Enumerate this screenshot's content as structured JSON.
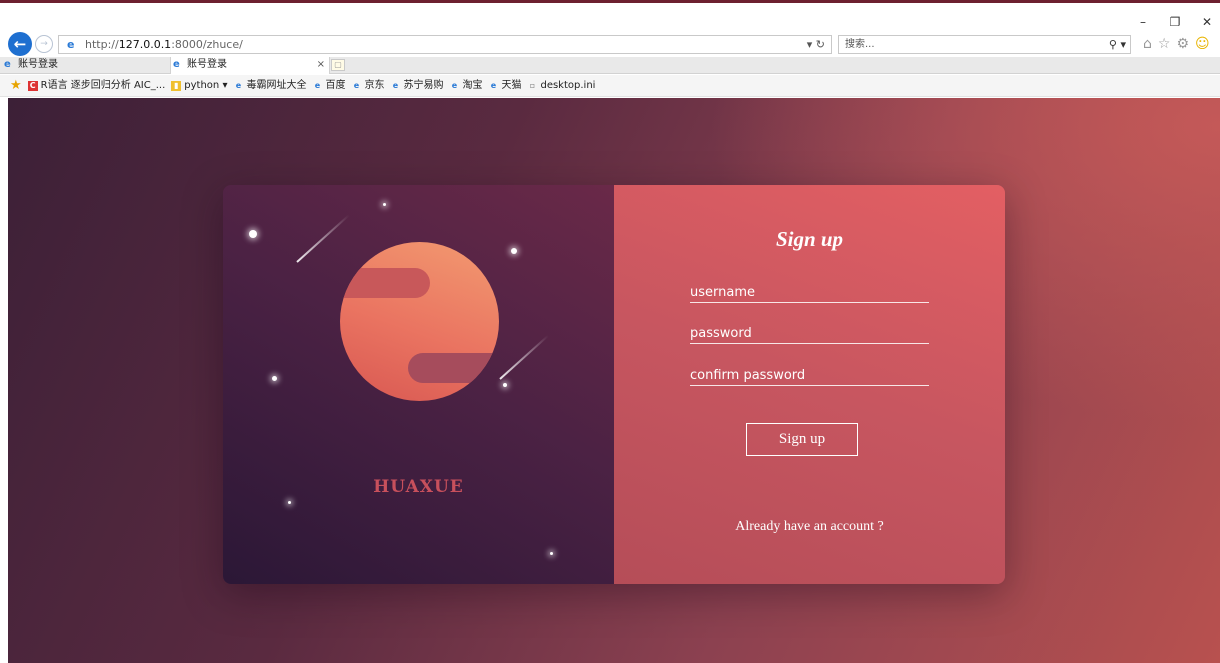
{
  "browser": {
    "url_prefix": "http://",
    "url_host": "127.0.0.1",
    "url_rest": ":8000/zhuce/",
    "url_tools": "▾ ↻",
    "search_placeholder": "搜索...",
    "search_tool": "⚲ ▾",
    "window_controls": {
      "minimize": "–",
      "maximize": "❐",
      "close": "✕"
    },
    "tabs": [
      {
        "label": "账号登录",
        "active": false
      },
      {
        "label": "账号登录",
        "active": true,
        "close": "×"
      }
    ],
    "favorites": [
      {
        "label": "R语言 逐步回归分析 AIC_...",
        "icon": "red"
      },
      {
        "label": "python ▾",
        "icon": "yellow"
      },
      {
        "label": "毒霸网址大全",
        "icon": "ie"
      },
      {
        "label": "百度",
        "icon": "ie"
      },
      {
        "label": "京东",
        "icon": "ie"
      },
      {
        "label": "苏宁易购",
        "icon": "ie"
      },
      {
        "label": "淘宝",
        "icon": "ie"
      },
      {
        "label": "天猫",
        "icon": "ie"
      },
      {
        "label": "desktop.ini",
        "icon": "file"
      }
    ]
  },
  "page": {
    "brand": "HUAXUE",
    "form": {
      "title": "Sign up",
      "username_placeholder": "username",
      "password_placeholder": "password",
      "confirm_placeholder": "confirm password",
      "submit_label": "Sign up",
      "login_link": "Already have an account ?"
    }
  },
  "colors": {
    "accent": "#e35f63",
    "brand_text": "#c8505c",
    "planet": "#ea7461",
    "left_panel": "#4c2244"
  }
}
